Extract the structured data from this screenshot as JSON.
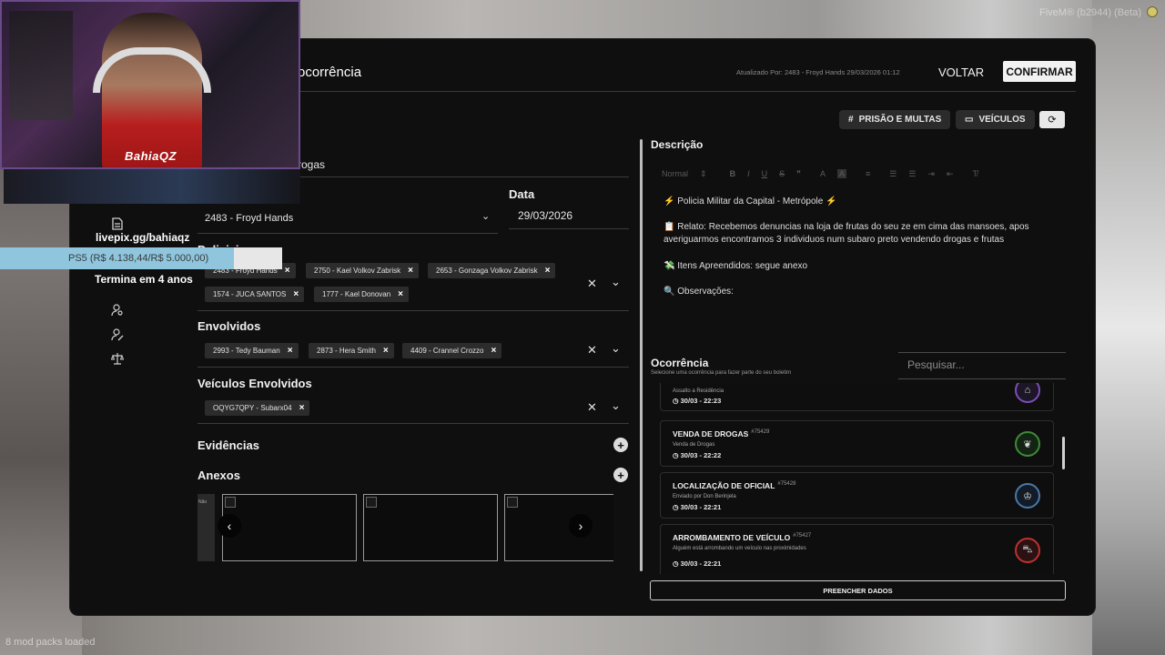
{
  "overlay": {
    "fivem_tag": "FiveM® (b2944) (Beta)",
    "mod_packs": "8 mod packs loaded",
    "stream_brand": "BahiaQZ",
    "livepix": "livepix.gg/bahiaqz",
    "goal_text": "PS5 (R$ 4.138,44/R$ 5.000,00)",
    "goal_progress_percent": 82.8,
    "termina": "Termina em 4 anos"
  },
  "header": {
    "title": "ocorrência",
    "updated_by": "Atualizado Por: 2483 - Froyd Hands 29/03/2026 01:12",
    "voltar_label": "VOLTAR",
    "confirmar_label": "CONFIRMAR"
  },
  "actions": {
    "prisao_label": "PRISÃO E MULTAS",
    "veiculos_label": "VEÍCULOS",
    "refresh_icon": "refresh-icon"
  },
  "sidebar": {
    "icons": [
      "document-icon",
      "user-search-icon",
      "user-edit-icon",
      "scale-icon"
    ]
  },
  "form": {
    "title_value": "rogas",
    "responsavel_value": "2483 - Froyd Hands",
    "data_label": "Data",
    "data_value": "29/03/2026",
    "policiais_label": "Policiais",
    "policiais": [
      "2483 - Froyd Hands",
      "2750 - Kael Volkov Zabrisk",
      "2653 - Gonzaga Volkov Zabrisk",
      "1574 - JUCA SANTOS",
      "1777 - Kael Donovan"
    ],
    "envolvidos_label": "Envolvidos",
    "envolvidos": [
      "2993 - Tedy Bauman",
      "2873 - Hera Smith",
      "4409 - Crannel Crozzo"
    ],
    "veiculos_label": "Veículos Envolvidos",
    "veiculos": [
      "OQYG7QPY - Subarx04"
    ],
    "evidencias_label": "Evidências",
    "anexos_label": "Anexos",
    "anexo_partial_label": "Não"
  },
  "description": {
    "title": "Descrição",
    "toolbar_style": "Normal",
    "lines": [
      "⚡ Policia Militar da Capital - Metrópole ⚡",
      "📋 Relato: Recebemos denuncias na loja de frutas do seu ze em cima das mansoes, apos averiguarmos encontramos 3 individuos num subaro preto vendendo drogas e frutas",
      "💸 Itens Apreendidos: segue anexo",
      "🔍 Observações:"
    ]
  },
  "ocorrencia": {
    "title": "Ocorrência",
    "subtitle": "Selecione uma ocorrência para fazer parte do seu boletim",
    "search_placeholder": "Pesquisar...",
    "cards": [
      {
        "title": "",
        "id": "",
        "sub": "Assalto a Residência",
        "date": "30/03 - 22:23",
        "color": "#7b4fb8",
        "icon": "house-alert-icon"
      },
      {
        "title": "VENDA DE DROGAS",
        "id": "#75429",
        "sub": "Venda de Drogas",
        "date": "30/03 - 22:22",
        "color": "#3f8a3a",
        "icon": "leaf-icon"
      },
      {
        "title": "LOCALIZAÇÃO DE OFICIAL",
        "id": "#75428",
        "sub": "Enviado por Don Berinjela",
        "date": "30/03 - 22:21",
        "color": "#4a78a8",
        "icon": "officer-icon"
      },
      {
        "title": "ARROMBAMENTO DE VEÍCULO",
        "id": "#75427",
        "sub": "Alguém está arrombando um veículo nas proximidades",
        "date": "30/03 - 22:21",
        "color": "#c03030",
        "icon": "car-break-icon"
      }
    ],
    "fill_label": "PREENCHER DADOS"
  }
}
